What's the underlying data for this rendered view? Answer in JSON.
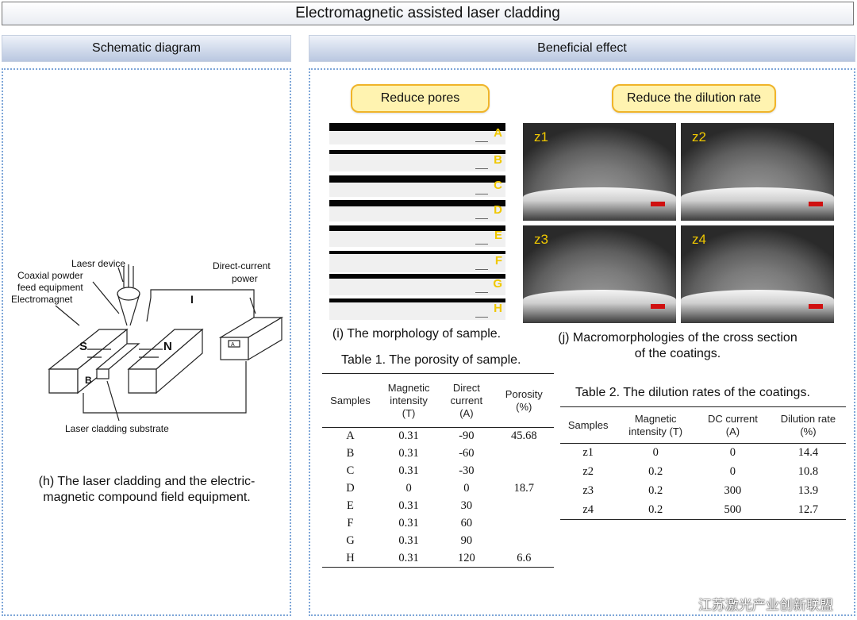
{
  "title": "Electromagnetic assisted laser cladding",
  "left_section": {
    "header": "Schematic diagram",
    "labels": {
      "laser_device": "Laesr device",
      "coaxial_powder": "Coaxial powder",
      "feed_equipment": "feed equipment",
      "electromagnet": "Electromagnet",
      "dc_power_1": "Direct-current",
      "dc_power_2": "power",
      "current": "I",
      "pole_s": "S",
      "pole_n": "N",
      "pole_b": "B",
      "substrate": "Laser cladding substrate",
      "panel_a": "A"
    },
    "caption_line1": "(h) The laser cladding and the electric-",
    "caption_line2": "magnetic compound field equipment."
  },
  "right_section": {
    "header": "Beneficial effect",
    "pill_left": "Reduce pores",
    "pill_right": "Reduce the dilution rate",
    "strips": [
      {
        "label": "A",
        "value": "-90"
      },
      {
        "label": "B",
        "value": "-60"
      },
      {
        "label": "C",
        "value": "-30"
      },
      {
        "label": "D",
        "value": "0"
      },
      {
        "label": "E",
        "value": "30"
      },
      {
        "label": "F",
        "value": "60"
      },
      {
        "label": "G",
        "value": "90"
      },
      {
        "label": "H",
        "value": "120"
      }
    ],
    "caption_i": "(i) The morphology of sample.",
    "micrographs": [
      "z1",
      "z2",
      "z3",
      "z4"
    ],
    "caption_j_line1": "(j) Macromorphologies of the cross section",
    "caption_j_line2": "of the coatings."
  },
  "table1": {
    "title": "Table 1. The porosity of sample.",
    "headers": [
      "Samples",
      "Magnetic intensity (T)",
      "Direct current (A)",
      "Porosity (%)"
    ],
    "header_lines": [
      [
        "Samples"
      ],
      [
        "Magnetic",
        "intensity",
        "(T)"
      ],
      [
        "Direct",
        "current",
        "(A)"
      ],
      [
        "Porosity",
        "(%)"
      ]
    ],
    "rows": [
      [
        "A",
        "0.31",
        "-90",
        "45.68"
      ],
      [
        "B",
        "0.31",
        "-60",
        ""
      ],
      [
        "C",
        "0.31",
        "-30",
        ""
      ],
      [
        "D",
        "0",
        "0",
        "18.7"
      ],
      [
        "E",
        "0.31",
        "30",
        ""
      ],
      [
        "F",
        "0.31",
        "60",
        ""
      ],
      [
        "G",
        "0.31",
        "90",
        ""
      ],
      [
        "H",
        "0.31",
        "120",
        "6.6"
      ]
    ]
  },
  "table2": {
    "title": "Table 2. The dilution rates of the coatings.",
    "header_lines": [
      [
        "Samples"
      ],
      [
        "Magnetic",
        "intensity (T)"
      ],
      [
        "DC current",
        "(A)"
      ],
      [
        "Dilution rate",
        "(%)"
      ]
    ],
    "rows": [
      [
        "z1",
        "0",
        "0",
        "14.4"
      ],
      [
        "z2",
        "0.2",
        "0",
        "10.8"
      ],
      [
        "z3",
        "0.2",
        "300",
        "13.9"
      ],
      [
        "z4",
        "0.2",
        "500",
        "12.7"
      ]
    ]
  },
  "watermark": "江苏激光产业创新联盟"
}
